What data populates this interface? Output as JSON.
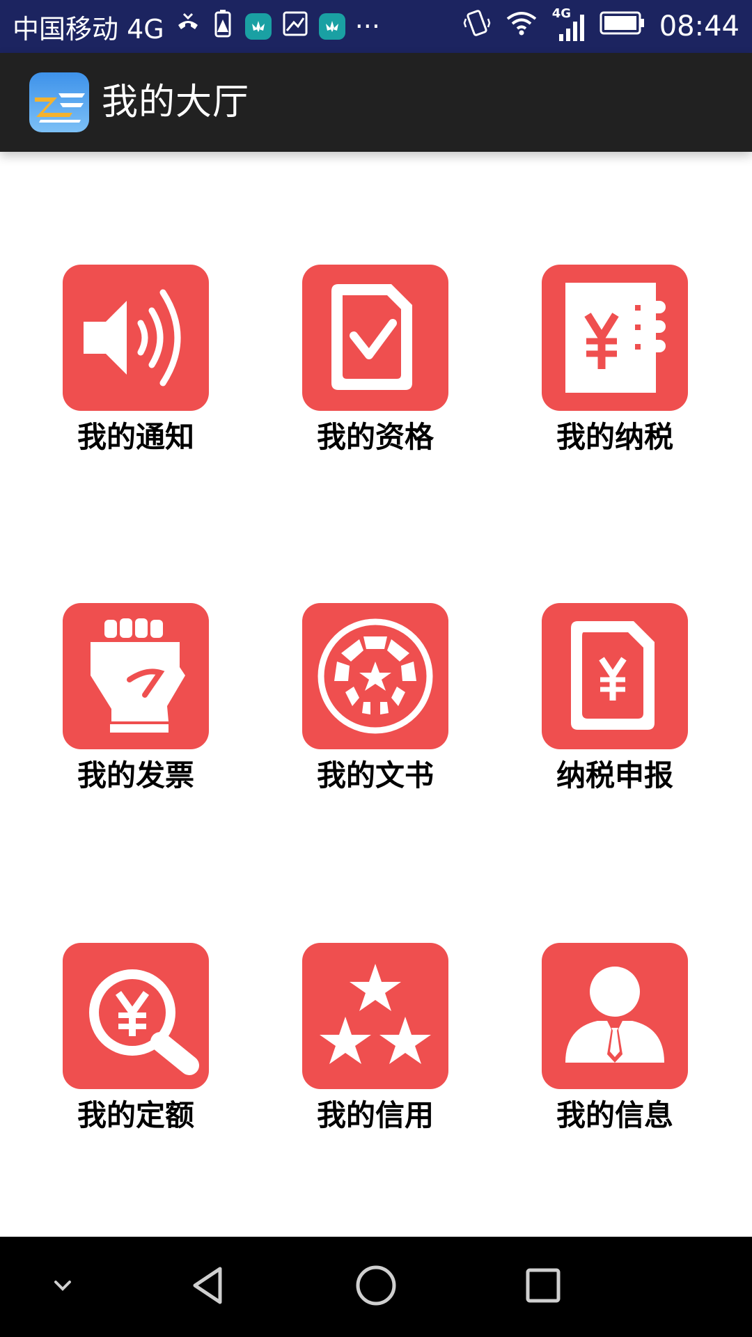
{
  "status_bar": {
    "carrier": "中国移动 4G",
    "time": "08:44",
    "network_label": "4G",
    "overflow_glyph": "···"
  },
  "app_bar": {
    "title": "我的大厅",
    "logo_icon": "tax-bureau-logo-icon"
  },
  "tiles": [
    {
      "label": "我的通知",
      "icon": "speaker-icon"
    },
    {
      "label": "我的资格",
      "icon": "document-check-icon"
    },
    {
      "label": "我的纳税",
      "icon": "ledger-yuan-icon"
    },
    {
      "label": "我的发票",
      "icon": "hand-invoice-icon"
    },
    {
      "label": "我的文书",
      "icon": "seal-star-icon"
    },
    {
      "label": "纳税申报",
      "icon": "document-yuan-icon"
    },
    {
      "label": "我的定额",
      "icon": "magnifier-yuan-icon"
    },
    {
      "label": "我的信用",
      "icon": "three-stars-icon"
    },
    {
      "label": "我的信息",
      "icon": "user-profile-icon"
    }
  ],
  "colors": {
    "tile_red": "#ef4f4f",
    "status_bar": "#1c2460",
    "app_bar": "#212121",
    "nav_bar": "#000000"
  }
}
